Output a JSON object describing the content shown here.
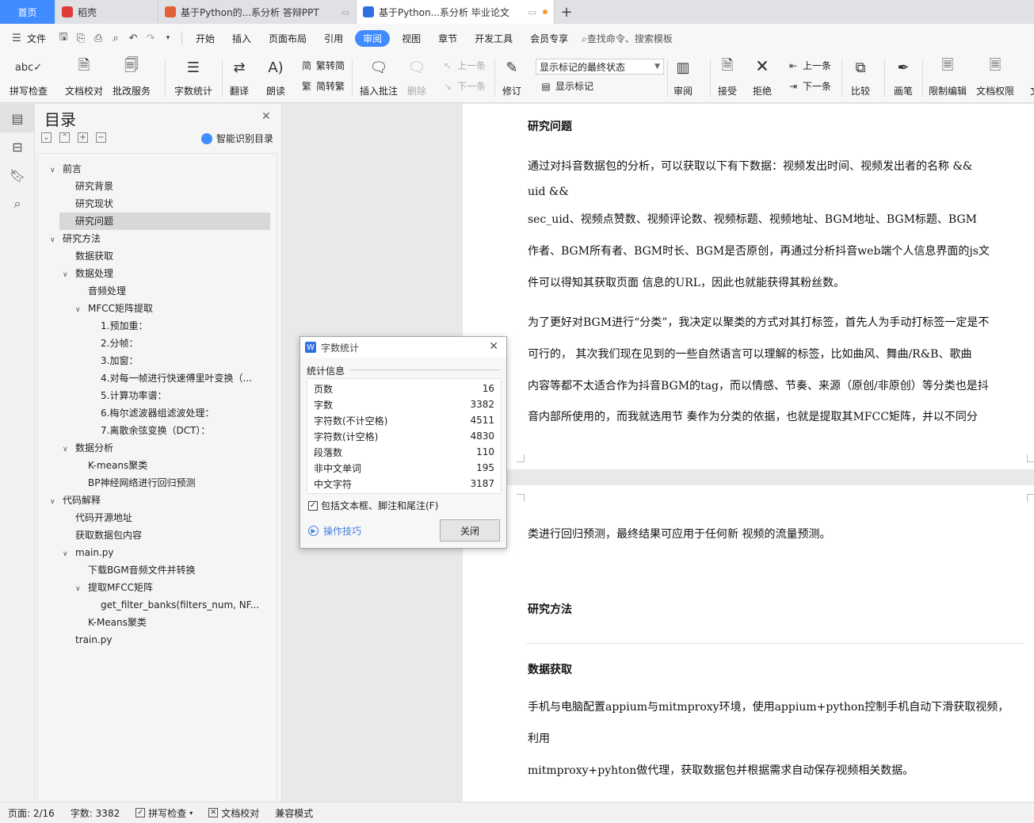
{
  "tabs": [
    {
      "label": "首页"
    },
    {
      "label": "稻壳",
      "icon_color": "#e03b3b"
    },
    {
      "label": "基于Python的...系分析 答辩PPT",
      "icon_color": "#e2603a"
    },
    {
      "label": "基于Python...系分析 毕业论文",
      "icon_color": "#2f6fe0"
    }
  ],
  "menu": {
    "file": "文件",
    "items": [
      "开始",
      "插入",
      "页面布局",
      "引用",
      "审阅",
      "视图",
      "章节",
      "开发工具",
      "会员专享"
    ],
    "active": "审阅",
    "search": "查找命令、搜索模板"
  },
  "ribbon": {
    "spell": "拼写检查",
    "proof": "文档校对",
    "batch": "批改服务",
    "wordcount": "字数统计",
    "translate": "翻译",
    "read": "朗读",
    "trad": "繁转简",
    "simp": "简转繁",
    "insert_comment": "插入批注",
    "delete": "删除",
    "prev_comment": "上一条",
    "next_comment": "下一条",
    "revise": "修订",
    "markup_mode": "显示标记的最终状态",
    "show_markup": "显示标记",
    "review": "审阅",
    "accept": "接受",
    "reject": "拒绝",
    "prev": "上一条",
    "next": "下一条",
    "compare": "比较",
    "pen": "画笔",
    "restrict": "限制编辑",
    "perm": "文档权限",
    "more": "文"
  },
  "toc": {
    "title": "目录",
    "smart": "智能识别目录",
    "items": [
      {
        "label": "前言",
        "level": 1,
        "caret": true
      },
      {
        "label": "研究背景",
        "level": 2
      },
      {
        "label": "研究现状",
        "level": 2
      },
      {
        "label": "研究问题",
        "level": 2,
        "selected": true
      },
      {
        "label": "研究方法",
        "level": 1,
        "caret": true
      },
      {
        "label": "数据获取",
        "level": 2
      },
      {
        "label": "数据处理",
        "level": 2,
        "caret": true
      },
      {
        "label": "音频处理",
        "level": 3
      },
      {
        "label": "MFCC矩阵提取",
        "level": 3,
        "caret": true
      },
      {
        "label": "1.预加重：",
        "level": 4
      },
      {
        "label": "2.分帧：",
        "level": 4
      },
      {
        "label": "3.加窗：",
        "level": 4
      },
      {
        "label": "4.对每一帧进行快速傅里叶变换（...",
        "level": 4
      },
      {
        "label": "5.计算功率谱：",
        "level": 4
      },
      {
        "label": "6.梅尔滤波器组滤波处理：",
        "level": 4
      },
      {
        "label": "7.离散余弦变换（DCT）：",
        "level": 4
      },
      {
        "label": "数据分析",
        "level": 2,
        "caret": true
      },
      {
        "label": "K-means聚类",
        "level": 3
      },
      {
        "label": "BP神经网络进行回归预测",
        "level": 3
      },
      {
        "label": "代码解释",
        "level": 1,
        "caret": true
      },
      {
        "label": "代码开源地址",
        "level": 2
      },
      {
        "label": "获取数据包内容",
        "level": 2
      },
      {
        "label": "main.py",
        "level": 2,
        "caret": true
      },
      {
        "label": "下载BGM音频文件并转换",
        "level": 3
      },
      {
        "label": "提取MFCC矩阵",
        "level": 3,
        "caret": true
      },
      {
        "label": "get_filter_banks(filters_num, NF...",
        "level": 4
      },
      {
        "label": "K-Means聚类",
        "level": 3
      },
      {
        "label": "train.py",
        "level": 2
      }
    ]
  },
  "document": {
    "heading1": "研究问题",
    "p1_l1": "通过对抖音数据包的分析，可以获取以下有下数据：视频发出时间、视频发出者的名称 &&",
    "p1_l2": "uid &&",
    "p1_l3": "sec_uid、视频点赞数、视频评论数、视频标题、视频地址、BGM地址、BGM标题、BGM",
    "p1_l4": "作者、BGM所有者、BGM时长、BGM是否原创，再通过分析抖音web端个人信息界面的js文",
    "p1_l5": "件可以得知其获取页面     信息的URL，因此也就能获得其粉丝数。",
    "p2_l1": "为了更好对BGM进行“分类”，我决定以聚类的方式对其打标签，首先人为手动打标签一定是不",
    "p2_l2": "可行的，     其次我们现在见到的一些自然语言可以理解的标签，比如曲风、舞曲/R&B、歌曲",
    "p2_l3": "内容等都不太适合作为抖音BGM的tag，而以情感、节奏、来源（原创/非原创）等分类也是抖",
    "p2_l4": "音内部所使用的，而我就选用节     奏作为分类的依据，也就是提取其MFCC矩阵，并以不同分",
    "p3_l1": "类进行回归预测，最终结果可应用于任何新     视频的流量预测。",
    "heading2": "研究方法",
    "heading3": "数据获取",
    "p4_l1": "手机与电脑配置appium与mitmproxy环境，使用appium+python控制手机自动下滑获取视频，",
    "p4_l2": "利用",
    "p4_l3": "mitmproxy+pyhton做代理，获取数据包并根据需求自动保存视频相关数据。"
  },
  "dialog": {
    "title": "字数统计",
    "section": "统计信息",
    "rows": [
      {
        "label": "页数",
        "value": "16"
      },
      {
        "label": "字数",
        "value": "3382"
      },
      {
        "label": "字符数(不计空格)",
        "value": "4511"
      },
      {
        "label": "字符数(计空格)",
        "value": "4830"
      },
      {
        "label": "段落数",
        "value": "110"
      },
      {
        "label": "非中文单词",
        "value": "195"
      },
      {
        "label": "中文字符",
        "value": "3187"
      }
    ],
    "checkbox": "包括文本框、脚注和尾注(F)",
    "tips": "操作技巧",
    "close": "关闭"
  },
  "status": {
    "page": "页面: 2/16",
    "words": "字数: 3382",
    "spell": "拼写检查",
    "proof": "文档校对",
    "compat": "兼容模式"
  },
  "colors": {
    "accent": "#3f8bff"
  }
}
